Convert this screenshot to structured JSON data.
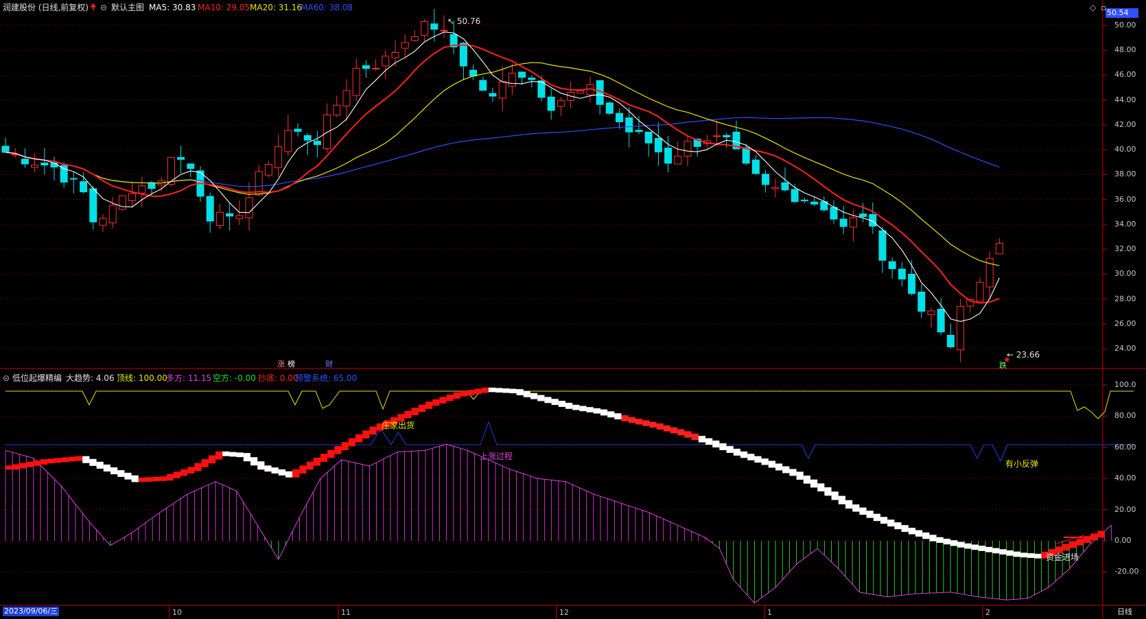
{
  "header": {
    "title": "润建股份 (日线,前复权)",
    "main_chart": "默认主图",
    "ma5": "MA5: 30.83",
    "ma10": "MA10: 29.05",
    "ma20": "MA20: 31.16",
    "ma60": "MA60: 38.08",
    "colors": {
      "ma5": "#ffffff",
      "ma10": "#ff2020",
      "ma20": "#e8e800",
      "ma60": "#3050ff"
    }
  },
  "sub_header": {
    "name": "低位起爆精编",
    "trend": "大趋势: 4.06",
    "top": "顶线: 100.00",
    "long": "多方: 11.15",
    "short": "空方: -0.00",
    "bottom": "抄底: 0.00",
    "warn": "预警系统: 65.00"
  },
  "price_axis": {
    "current": "50.54",
    "labels": [
      "50.00",
      "48.00",
      "46.00",
      "44.00",
      "42.00",
      "40.00",
      "38.00",
      "36.00",
      "34.00",
      "32.00",
      "30.00",
      "28.00",
      "26.00",
      "24.00"
    ]
  },
  "sub_axis": {
    "labels": [
      "100.0",
      "80.00",
      "60.00",
      "40.00",
      "20.00",
      "0.00",
      "-20.00"
    ]
  },
  "annotations": {
    "high": "50.76",
    "low": "23.66",
    "markers": [
      "涨",
      "榜",
      "财",
      "跌"
    ],
    "sub": [
      "庄家出货",
      "上涨过程",
      "有小反弹",
      "资金进场"
    ]
  },
  "x_axis": {
    "date": "2023/09/06/三",
    "months": [
      "10",
      "11",
      "12",
      "1",
      "2"
    ],
    "period": "日线"
  }
}
